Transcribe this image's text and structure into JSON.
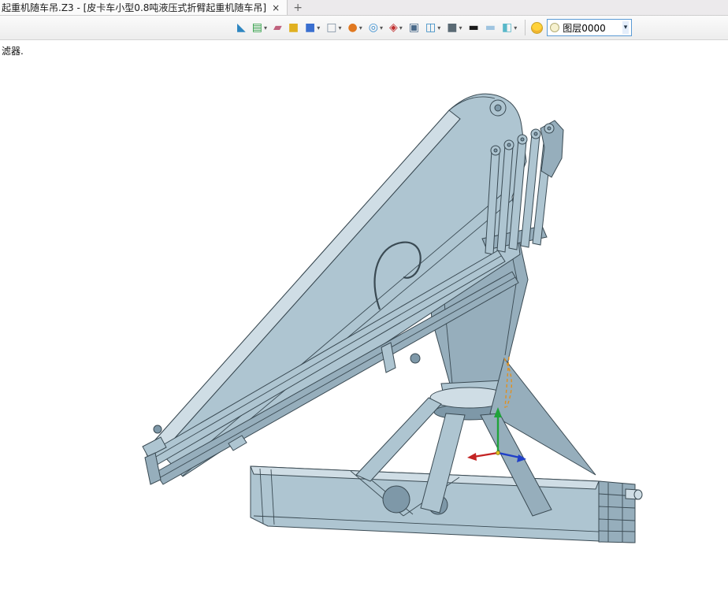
{
  "tabbar": {
    "title": "起重机随车吊.Z3 - [皮卡车小型0.8吨液压式折臂起重机随车吊]",
    "close_glyph": "×",
    "new_tab_glyph": "+"
  },
  "toolbar": {
    "layer_value": "图层0000",
    "caret_glyph": "▾",
    "icons": [
      {
        "name": "view-plane-icon",
        "glyph": "◣",
        "color": "#2e86c1",
        "dropdown": false
      },
      {
        "name": "layer-stack-icon",
        "glyph": "▤",
        "color": "#2e9e44",
        "dropdown": true
      },
      {
        "name": "erase-display-icon",
        "glyph": "▰",
        "color": "#c0627e",
        "dropdown": false
      },
      {
        "name": "solid-box-yellow-icon",
        "glyph": "■",
        "color": "#e0b020",
        "dropdown": false
      },
      {
        "name": "solid-box-blue-icon",
        "glyph": "■",
        "color": "#3a6fd0",
        "dropdown": true
      },
      {
        "name": "wireframe-cube-icon",
        "glyph": "□",
        "color": "#7b8da0",
        "dropdown": true
      },
      {
        "name": "render-mode-icon",
        "glyph": "●",
        "color": "#e07820",
        "dropdown": true
      },
      {
        "name": "zoom-display-icon",
        "glyph": "◎",
        "color": "#3a8fd0",
        "dropdown": true
      },
      {
        "name": "move-view-icon",
        "glyph": "◈",
        "color": "#c03030",
        "dropdown": true
      },
      {
        "name": "viewport-window-icon",
        "glyph": "▣",
        "color": "#4a6a8a",
        "dropdown": false
      },
      {
        "name": "section-view-icon",
        "glyph": "◫",
        "color": "#2e86c1",
        "dropdown": true
      },
      {
        "name": "shaded-cube-icon",
        "glyph": "■",
        "color": "#5a6a74",
        "dropdown": true
      },
      {
        "name": "background-dark-icon",
        "glyph": "▬",
        "color": "#1a1a1a",
        "dropdown": false
      },
      {
        "name": "background-light-icon",
        "glyph": "▬",
        "color": "#9fc4e0",
        "dropdown": false
      },
      {
        "name": "appearance-swatch-icon",
        "glyph": "◧",
        "color": "#59b8c9",
        "dropdown": true
      }
    ]
  },
  "canvas": {
    "filter_label": "滤器."
  },
  "colors": {
    "tabbar_bg": "#eceaec",
    "tab_active_bg": "#fbfbfb",
    "canvas_bg": "#ffffff",
    "combo_border": "#5b9bd5",
    "bulb_yellow": "#ffd23a",
    "model_body": "#aec5d1",
    "model_body_dark": "#96aebc",
    "model_body_darker": "#7e98a8",
    "model_highlight": "#cfdde5",
    "model_outline": "#3a4a53",
    "axis_x_red": "#c42424",
    "axis_y_blue": "#2040c8",
    "axis_z_green": "#1fa33a",
    "guide_orange": "#e09020"
  }
}
